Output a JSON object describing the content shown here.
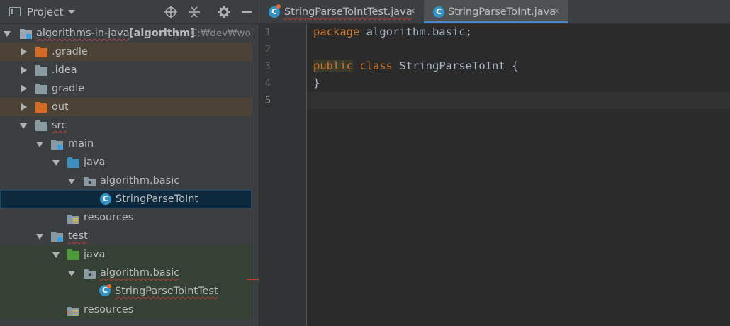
{
  "project_panel": {
    "title": "Project",
    "header_icons": [
      "locate-icon",
      "collapse-all-icon",
      "settings-icon",
      "hide-icon"
    ]
  },
  "tree": [
    {
      "label": "algorithms-in-java",
      "module": "[algorithm]",
      "path": "C:₩dev₩works",
      "icon": "module-icon",
      "expanded": true
    },
    {
      "label": ".gradle",
      "icon": "folder-icon",
      "expanded": false
    },
    {
      "label": ".idea",
      "icon": "folder-icon",
      "expanded": false
    },
    {
      "label": "gradle",
      "icon": "folder-icon",
      "expanded": false
    },
    {
      "label": "out",
      "icon": "folder-icon",
      "expanded": false
    },
    {
      "label": "src",
      "icon": "folder-icon",
      "expanded": true
    },
    {
      "label": "main",
      "icon": "module-folder-icon",
      "expanded": true
    },
    {
      "label": "java",
      "icon": "source-folder-icon",
      "expanded": true
    },
    {
      "label": "algorithm.basic",
      "icon": "package-icon",
      "expanded": true
    },
    {
      "label": "StringParseToInt",
      "icon": "class-icon"
    },
    {
      "label": "resources",
      "icon": "resources-folder-icon"
    },
    {
      "label": "test",
      "icon": "module-folder-icon",
      "expanded": true
    },
    {
      "label": "java",
      "icon": "test-source-folder-icon",
      "expanded": true
    },
    {
      "label": "algorithm.basic",
      "icon": "package-icon",
      "expanded": true
    },
    {
      "label": "StringParseToIntTest",
      "icon": "test-class-icon"
    },
    {
      "label": "resources",
      "icon": "test-resources-folder-icon"
    }
  ],
  "editor": {
    "tabs": [
      {
        "label": "StringParseToIntTest.java",
        "icon": "test-class-icon",
        "active": false
      },
      {
        "label": "StringParseToInt.java",
        "icon": "class-icon",
        "active": true
      }
    ],
    "line_numbers": [
      "1",
      "2",
      "3",
      "4",
      "5"
    ],
    "lines": {
      "l1_kw": "package",
      "l1_rest": " algorithm.basic;",
      "l3_kw1": "public",
      "l3_kw2": "class",
      "l3_rest": " StringParseToInt {",
      "l4": "}"
    },
    "current_line": 5
  },
  "colors": {
    "excluded_row": "#4d4236",
    "selected_row": "#0d293e",
    "test_row": "#344134",
    "keyword": "#cc7832",
    "accent": "#4a88c7"
  }
}
